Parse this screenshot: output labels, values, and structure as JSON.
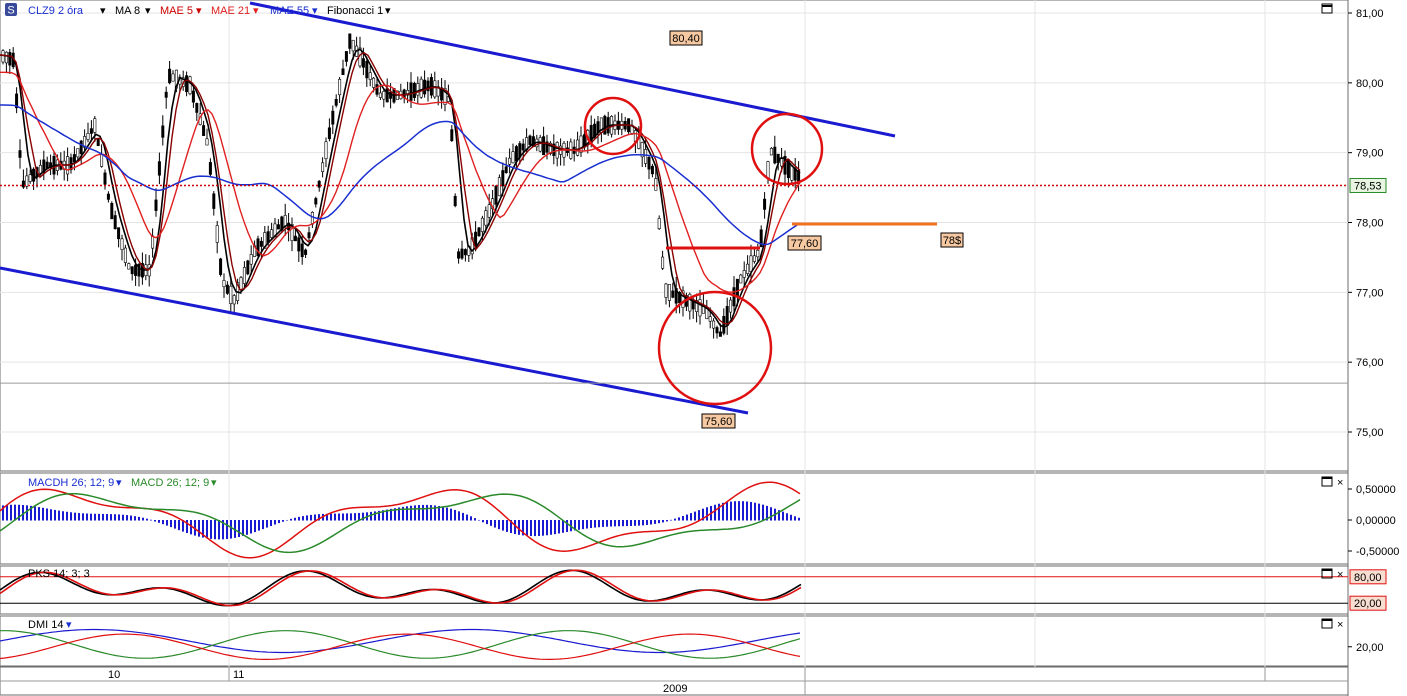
{
  "header": {
    "symbol": "CLZ9 2 óra",
    "indicators": [
      {
        "label": "MA 8",
        "color": "#000000"
      },
      {
        "label": "MAE 5",
        "color": "#cc0000"
      },
      {
        "label": "MAE 21",
        "color": "#e02020"
      },
      {
        "label": "MAE 55",
        "color": "#1a2fd0"
      },
      {
        "label": "Fibonacci 1",
        "color": "#000000"
      }
    ]
  },
  "colors": {
    "price_line": "#cc0000",
    "channel": "#1a1ad0",
    "circle": "#e01010",
    "orange": "#f07020",
    "macd_hist": "#1a1ad0",
    "macd": "#2a8a2a",
    "pks_k": "#000000",
    "pks_d": "#e01010"
  },
  "chart_data": [
    {
      "type": "candlestick",
      "panel": "price",
      "y_ticks": [
        "81,00",
        "80,00",
        "79,00",
        "78,00",
        "77,00",
        "76,00",
        "75,00"
      ],
      "ylim": [
        74.45,
        81.15
      ],
      "current_price": {
        "value": 78.53,
        "label": "78,53"
      },
      "horizontal_line": {
        "value": 75.7
      },
      "annotations": [
        {
          "text": "80,40",
          "value": 80.4
        },
        {
          "text": "77,60",
          "value": 77.6
        },
        {
          "text": "75,60",
          "value": 75.6
        },
        {
          "text": "78$",
          "value": 78.0
        }
      ],
      "x_ticks": [
        "10",
        "11"
      ],
      "x_bottom_label": "2009",
      "series": [
        {
          "name": "MA 8"
        },
        {
          "name": "MAE 5"
        },
        {
          "name": "MAE 21"
        },
        {
          "name": "MAE 55"
        }
      ]
    },
    {
      "type": "line",
      "panel": "macd",
      "title_items": [
        "MACDH 26; 12; 9",
        "MACD 26; 12; 9"
      ],
      "y_ticks": [
        "0,50000",
        "0,00000",
        "-0,50000"
      ],
      "ylim": [
        -0.6,
        0.6
      ]
    },
    {
      "type": "line",
      "panel": "pks",
      "title_items": [
        "PKS 14; 3; 3"
      ],
      "levels": [
        {
          "value": 80,
          "label": "80,00"
        },
        {
          "value": 20,
          "label": "20,00"
        }
      ],
      "ylim": [
        0,
        100
      ]
    },
    {
      "type": "line",
      "panel": "dmi",
      "title_items": [
        "DMI 14"
      ],
      "y_ticks": [
        "20,00"
      ],
      "ylim": [
        5,
        45
      ]
    }
  ]
}
